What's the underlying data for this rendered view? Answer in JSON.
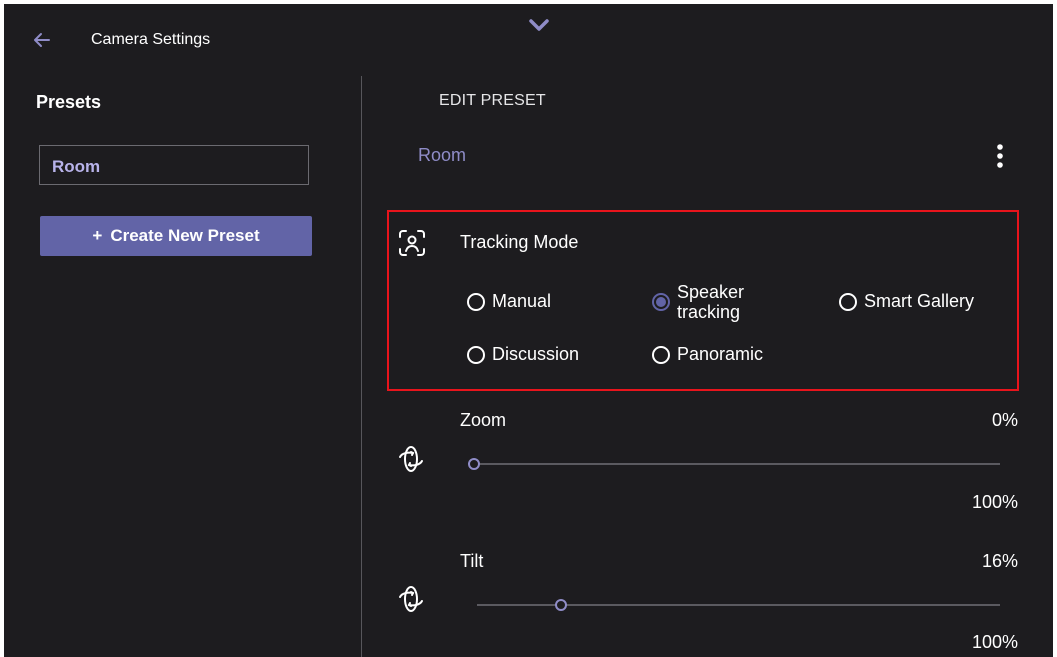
{
  "header": {
    "back_icon": "arrow-left-icon",
    "title": "Camera Settings",
    "collapse_icon": "chevron-down-icon"
  },
  "sidebar": {
    "heading": "Presets",
    "presets": [
      {
        "label": "Room"
      }
    ],
    "create_button": {
      "icon": "+",
      "label": "Create New Preset"
    }
  },
  "editor": {
    "section_label": "EDIT PRESET",
    "preset_name": "Room",
    "more_icon": "more-vertical-icon",
    "tracking": {
      "icon": "person-scan-icon",
      "label": "Tracking Mode",
      "options": [
        {
          "label": "Manual",
          "selected": false
        },
        {
          "label": "Speaker tracking",
          "line1": "Speaker",
          "line2": "tracking",
          "selected": true
        },
        {
          "label": "Smart Gallery",
          "selected": false
        },
        {
          "label": "Discussion",
          "selected": false
        },
        {
          "label": "Panoramic",
          "selected": false
        }
      ]
    },
    "zoom": {
      "icon": "rotate-3d-icon",
      "label": "Zoom",
      "value_text": "0%",
      "max_text": "100%",
      "value": 0
    },
    "tilt": {
      "icon": "rotate-3d-icon",
      "label": "Tilt",
      "value_text": "16%",
      "max_text": "100%",
      "value": 16
    }
  },
  "colors": {
    "background": "#1d1c1f",
    "accent": "#6264a7",
    "accent_text": "#8f8cc7",
    "highlight": "#e8141c"
  }
}
